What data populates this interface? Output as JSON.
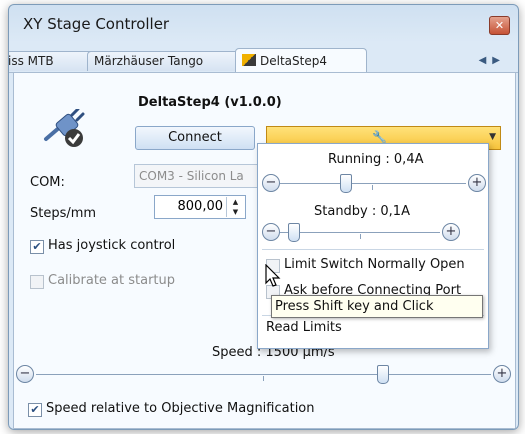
{
  "window": {
    "title": "XY Stage Controller",
    "close_glyph": "✕"
  },
  "tabs": [
    {
      "label": "iss MTB"
    },
    {
      "label": "Märzhäuser Tango"
    },
    {
      "label": "DeltaStep4",
      "icon": "deltastep-icon",
      "active": true
    }
  ],
  "tab_nav": {
    "prev": "◀",
    "next": "▶"
  },
  "device": {
    "title": "DeltaStep4 (v1.0.0)",
    "connect_label": "Connect",
    "com_label": "COM:",
    "com_value": "COM3 - Silicon La",
    "steps_label": "Steps/mm",
    "steps_value": "800,00",
    "has_joystick_label": "Has joystick control",
    "has_joystick_checked": true,
    "calibrate_label": "Calibrate at startup",
    "calibrate_checked": false
  },
  "dropdown": {
    "arrow": "▼"
  },
  "popup": {
    "running_label": "Running : 0,4A",
    "running_fraction": 0.35,
    "standby_label": "Standby : 0,1A",
    "standby_fraction": 0.08,
    "limit_switch_label": "Limit Switch Normally Open",
    "ask_before_label": "Ask before Connecting Port",
    "read_limits_label": "Read Limits"
  },
  "tooltip": {
    "text": "Press Shift key and Click"
  },
  "speed": {
    "label": "Speed : 1500 µm/s",
    "fraction": 0.76,
    "relative_label": "Speed relative to Objective Magnification",
    "relative_checked": true
  },
  "slider_buttons": {
    "minus": "−",
    "plus": "+"
  },
  "colors": {
    "accent": "#f7c43c",
    "border": "#8aa7c9",
    "panel": "#f7fbff"
  }
}
